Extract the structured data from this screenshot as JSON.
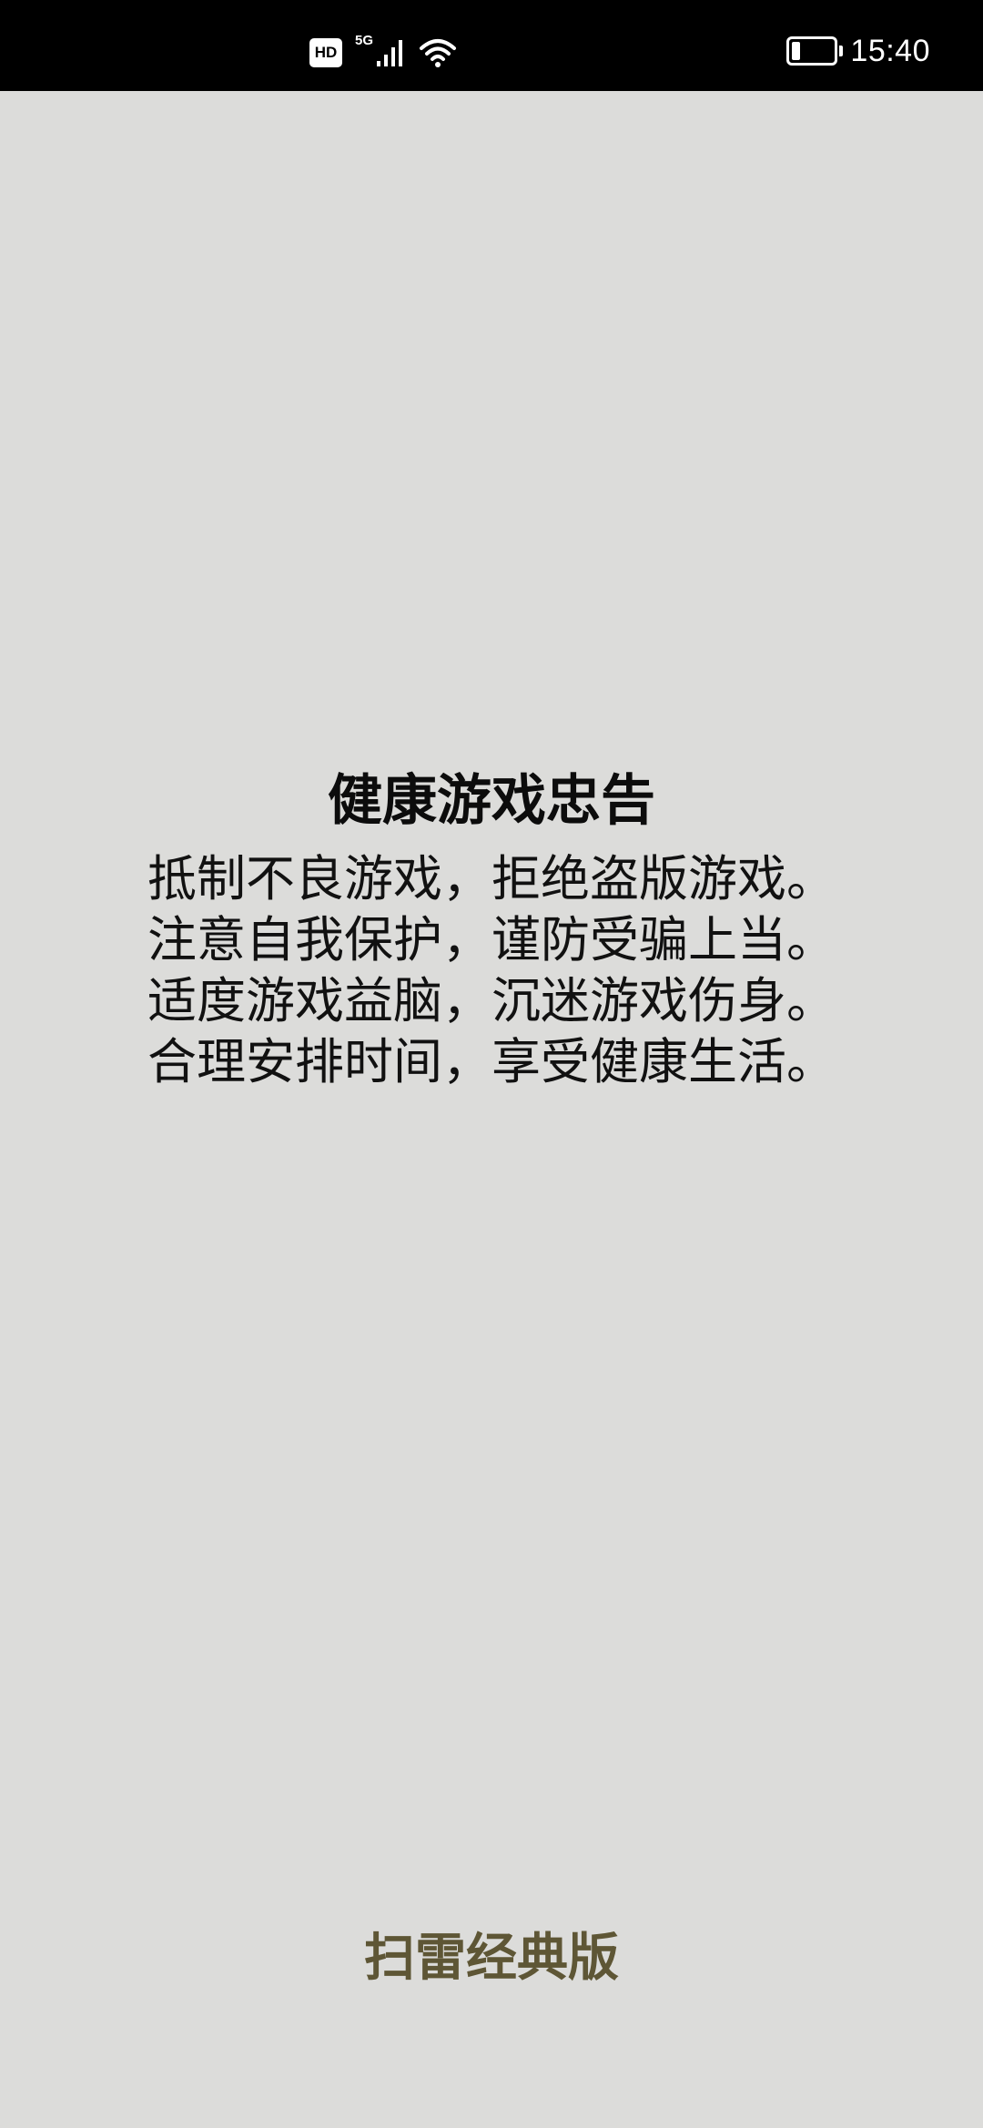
{
  "status_bar": {
    "hd_label": "HD",
    "network_label": "5G",
    "time": "15:40",
    "battery_level": 0.2,
    "icons": [
      "hd-icon",
      "signal-icon",
      "wifi-icon",
      "battery-icon"
    ]
  },
  "notice": {
    "title": "健康游戏忠告",
    "lines": [
      "抵制不良游戏，拒绝盗版游戏。",
      "注意自我保护，谨防受骗上当。",
      "适度游戏益脑，沉迷游戏伤身。",
      "合理安排时间，享受健康生活。"
    ]
  },
  "app": {
    "name": "扫雷经典版"
  },
  "colors": {
    "background": "#dcdcda",
    "status_bar": "#000000",
    "title_text": "#0c0c0c",
    "app_name": "#5e5635"
  }
}
